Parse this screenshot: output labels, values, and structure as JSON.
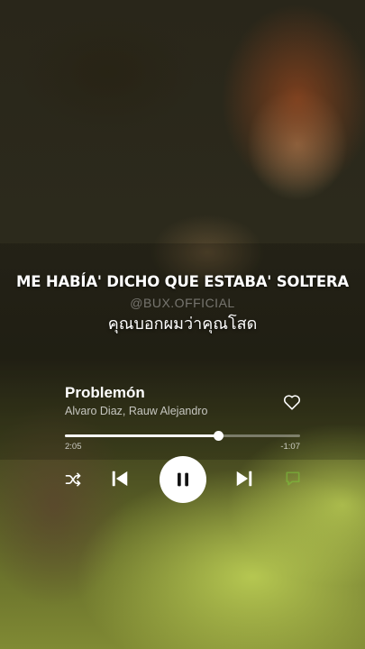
{
  "lyrics": {
    "current_line": "ME HABÍA' DICHO QUE ESTABA' SOLTERA",
    "watermark": "@BUX.OFFICIAL",
    "translation": "คุณบอกผมว่าคุณโสด"
  },
  "track": {
    "title": "Problemón",
    "artists": "Alvaro Diaz, Rauw Alejandro",
    "liked": false
  },
  "playback": {
    "elapsed": "2:05",
    "remaining": "-1:07",
    "progress_fraction": 0.65,
    "state": "playing"
  },
  "icons": {
    "like": "heart-outline-icon",
    "shuffle": "shuffle-icon",
    "previous": "skip-previous-icon",
    "play_pause": "pause-icon",
    "next": "skip-next-icon",
    "lyrics": "speech-bubble-icon"
  },
  "colors": {
    "lyrics_accent": "#7dcc3c"
  }
}
